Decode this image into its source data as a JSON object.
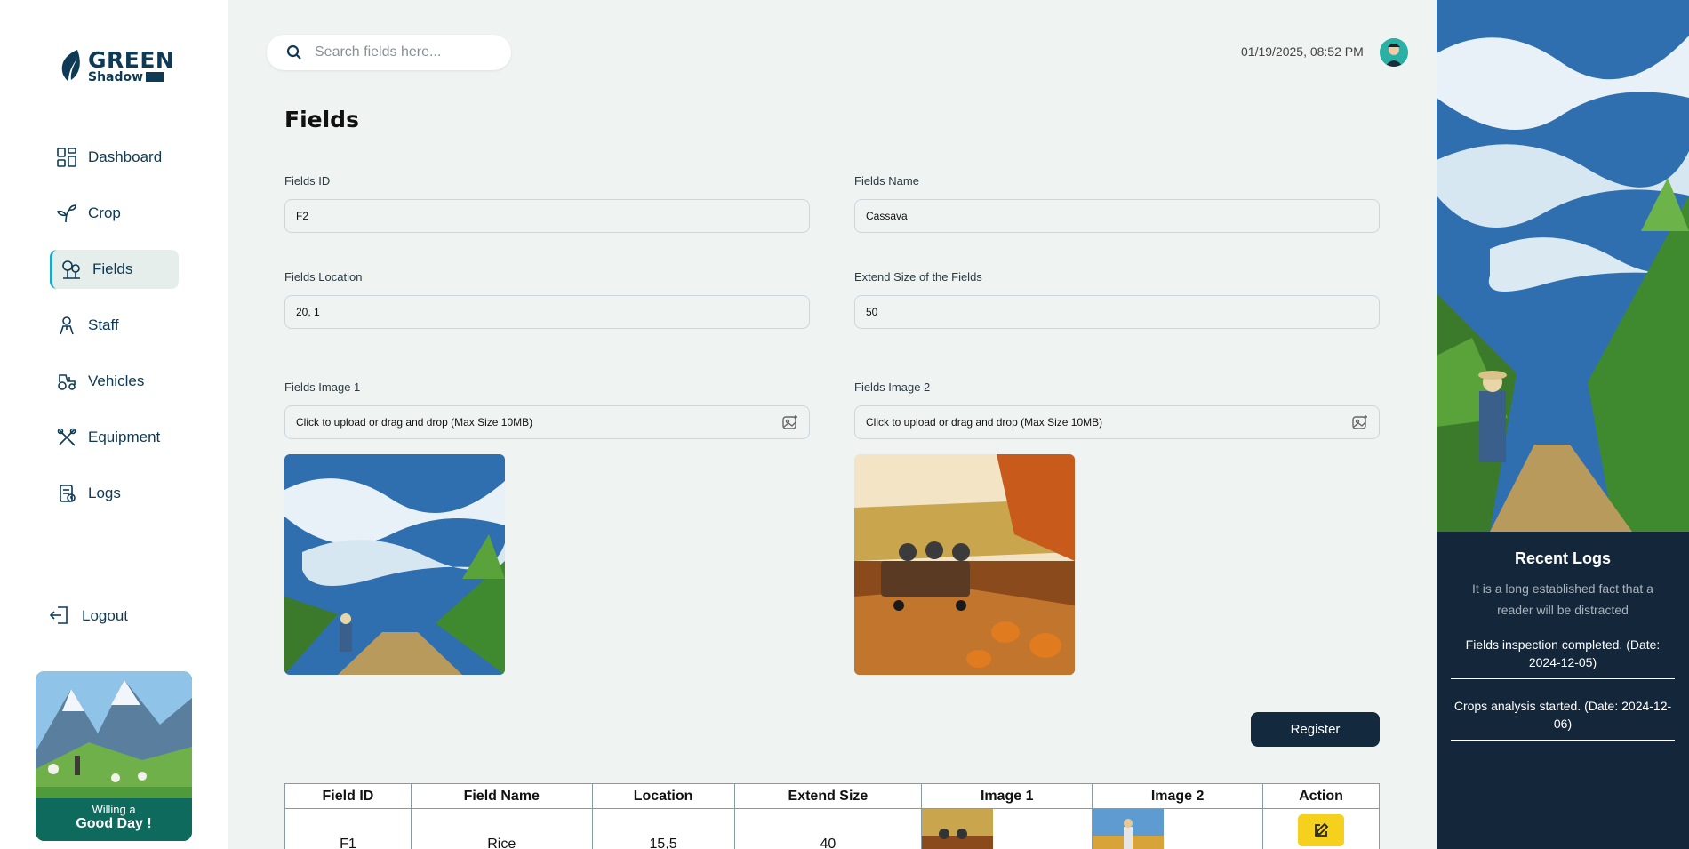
{
  "brand": {
    "name_top": "GREEN",
    "name_bottom": "Shadow"
  },
  "sidebar": {
    "items": [
      {
        "label": "Dashboard",
        "icon": "dashboard-icon",
        "active": false
      },
      {
        "label": "Crop",
        "icon": "sprout-icon",
        "active": false
      },
      {
        "label": "Fields",
        "icon": "tree-icon",
        "active": true
      },
      {
        "label": "Staff",
        "icon": "person-icon",
        "active": false
      },
      {
        "label": "Vehicles",
        "icon": "tractor-icon",
        "active": false
      },
      {
        "label": "Equipment",
        "icon": "tools-icon",
        "active": false
      },
      {
        "label": "Logs",
        "icon": "log-icon",
        "active": false
      }
    ],
    "logout_label": "Logout",
    "promo": {
      "line1": "Willing a",
      "line2": "Good Day !"
    }
  },
  "header": {
    "search_placeholder": "Search fields here...",
    "datetime": "01/19/2025, 08:52 PM"
  },
  "page": {
    "title": "Fields"
  },
  "form": {
    "field_id": {
      "label": "Fields ID",
      "value": "F2"
    },
    "field_name": {
      "label": "Fields Name",
      "value": "Cassava"
    },
    "field_location": {
      "label": "Fields Location",
      "value": "20, 1"
    },
    "extend_size": {
      "label": "Extend Size of the Fields",
      "value": "50"
    },
    "image1": {
      "label": "Fields Image 1",
      "upload_text": "Click to upload or drag and drop (Max Size 10MB)"
    },
    "image2": {
      "label": "Fields Image 2",
      "upload_text": "Click to upload or drag and drop (Max Size 10MB)"
    },
    "register_label": "Register"
  },
  "table": {
    "headers": [
      "Field ID",
      "Field Name",
      "Location",
      "Extend Size",
      "Image 1",
      "Image 2",
      "Action"
    ],
    "rows": [
      {
        "id": "F1",
        "name": "Rice",
        "location": "15,5",
        "size": "40"
      }
    ]
  },
  "right_panel": {
    "title": "Recent Logs",
    "subtitle": "It is a long established fact that a reader will be distracted",
    "logs": [
      "Fields inspection completed. (Date: 2024-12-05)",
      "Crops analysis started. (Date: 2024-12-06)"
    ]
  },
  "colors": {
    "accent": "#1fa7bf",
    "navy": "#13293d",
    "edit": "#f5d01d",
    "background": "#eff4f2"
  }
}
